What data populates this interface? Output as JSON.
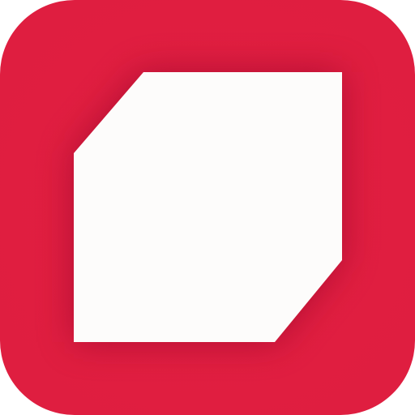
{
  "app_icon": {
    "name": "app-icon",
    "colors": {
      "background": "#e01e40",
      "background_edge": "#c8183a",
      "shadow": "#8a0f26",
      "glyph": "#fdfcfb"
    },
    "glyph_icon": "chamfered-square-icon"
  }
}
